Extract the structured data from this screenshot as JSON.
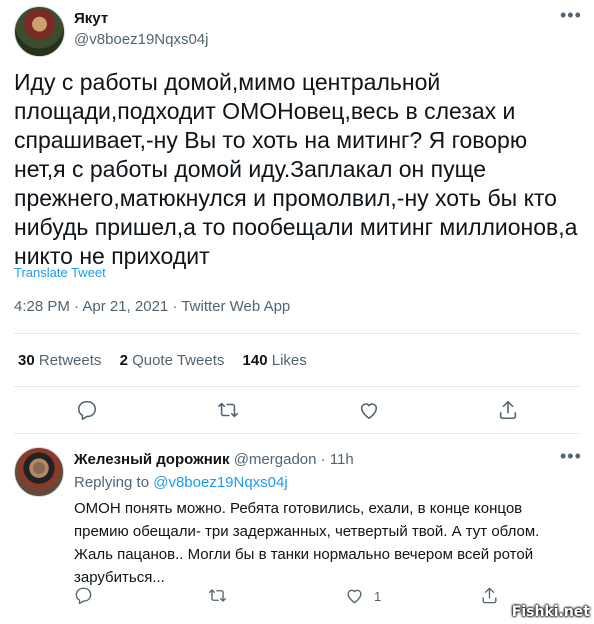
{
  "tweet": {
    "author_name": "Якут",
    "author_handle": "@v8boez19Nqxs04j",
    "text": "Иду с работы домой,мимо центральной\nплощади,подходит ОМОНовец,весь в слезах и\nспрашивает,-ну Вы то хоть на митинг? Я говорю\nнет,я с работы домой иду.Заплакал он пуще\nпрежнего,матюкнулся и промолвил,-ну хоть бы кто\nнибудь пришел,а то пообещали митинг миллионов,а\nникто не приходит",
    "translate_label": "Translate Tweet",
    "meta": "4:28 PM · Apr 21, 2021 · Twitter Web App",
    "stats": {
      "retweets_count": "30",
      "retweets_label": "Retweets",
      "quotes_count": "2",
      "quotes_label": "Quote Tweets",
      "likes_count": "140",
      "likes_label": "Likes"
    },
    "actions": [
      "reply-icon",
      "retweet-icon",
      "like-icon",
      "share-icon"
    ]
  },
  "reply": {
    "author_name": "Железный дорожник",
    "author_handle": "@mergadon",
    "separator": "·",
    "time": "11h",
    "replying_prefix": "Replying to",
    "replying_handle": "@v8boez19Nqxs04j",
    "text": "ОМОН понять можно. Ребята готовились, ехали,  в конце концов\nпремию обещали- три задержанных, четвертый твой.  А тут облом.\nЖаль пацанов.. Могли бы в  танки нормально вечером всей ротой\nзарубиться...",
    "like_count": "1"
  },
  "watermark": "Fishki.net",
  "colors": {
    "link": "#1d9bf0",
    "secondary_text": "#536471",
    "divider": "#e6e9eb"
  }
}
